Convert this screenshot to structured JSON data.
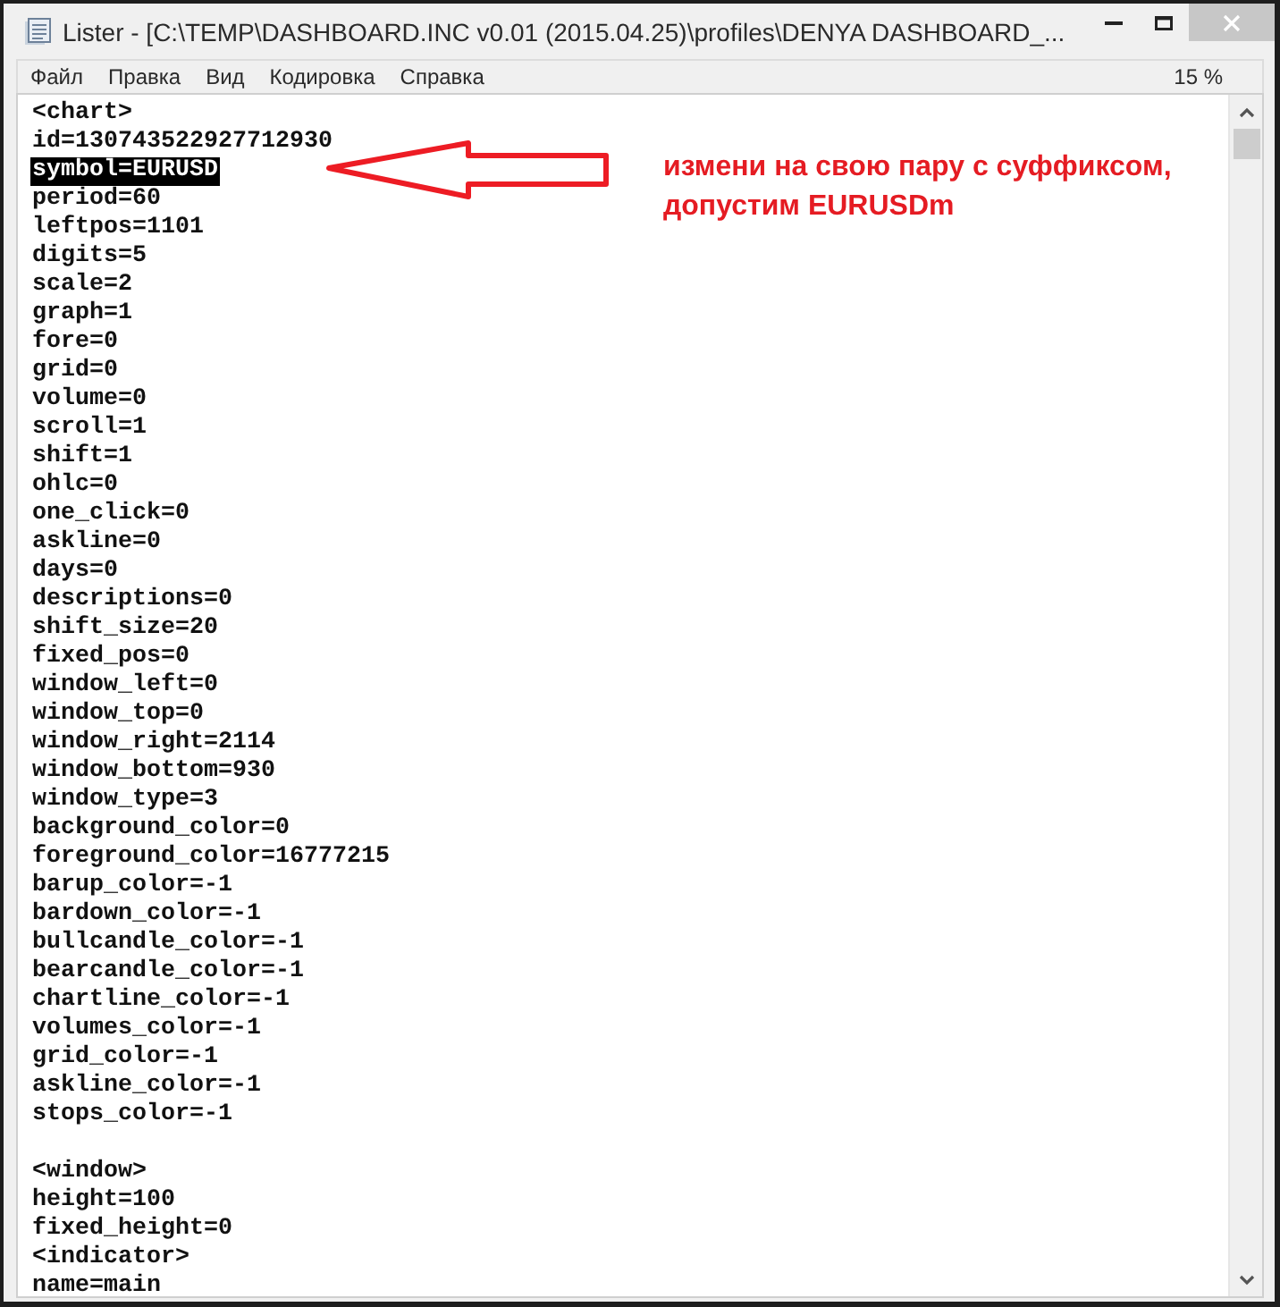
{
  "window": {
    "title": "Lister - [C:\\TEMP\\DASHBOARD.INC v0.01 (2015.04.25)\\profiles\\DENYA DASHBOARD_..."
  },
  "menu": {
    "items": [
      "Файл",
      "Правка",
      "Вид",
      "Кодировка",
      "Справка"
    ],
    "percent": "15 %"
  },
  "editor": {
    "blocks": [
      {
        "lines": [
          {
            "text": "<chart>",
            "selected": false
          },
          {
            "text": "id=130743522927712930",
            "selected": false
          },
          {
            "text": "symbol=EURUSD",
            "selected": true
          },
          {
            "text": "period=60",
            "selected": false
          },
          {
            "text": "leftpos=1101",
            "selected": false
          },
          {
            "text": "digits=5",
            "selected": false
          },
          {
            "text": "scale=2",
            "selected": false
          },
          {
            "text": "graph=1",
            "selected": false
          },
          {
            "text": "fore=0",
            "selected": false
          },
          {
            "text": "grid=0",
            "selected": false
          },
          {
            "text": "volume=0",
            "selected": false
          },
          {
            "text": "scroll=1",
            "selected": false
          },
          {
            "text": "shift=1",
            "selected": false
          },
          {
            "text": "ohlc=0",
            "selected": false
          },
          {
            "text": "one_click=0",
            "selected": false
          },
          {
            "text": "askline=0",
            "selected": false
          },
          {
            "text": "days=0",
            "selected": false
          },
          {
            "text": "descriptions=0",
            "selected": false
          },
          {
            "text": "shift_size=20",
            "selected": false
          },
          {
            "text": "fixed_pos=0",
            "selected": false
          },
          {
            "text": "window_left=0",
            "selected": false
          },
          {
            "text": "window_top=0",
            "selected": false
          },
          {
            "text": "window_right=2114",
            "selected": false
          },
          {
            "text": "window_bottom=930",
            "selected": false
          },
          {
            "text": "window_type=3",
            "selected": false
          },
          {
            "text": "background_color=0",
            "selected": false
          },
          {
            "text": "foreground_color=16777215",
            "selected": false
          },
          {
            "text": "barup_color=-1",
            "selected": false
          },
          {
            "text": "bardown_color=-1",
            "selected": false
          },
          {
            "text": "bullcandle_color=-1",
            "selected": false
          },
          {
            "text": "bearcandle_color=-1",
            "selected": false
          },
          {
            "text": "chartline_color=-1",
            "selected": false
          },
          {
            "text": "volumes_color=-1",
            "selected": false
          },
          {
            "text": "grid_color=-1",
            "selected": false
          },
          {
            "text": "askline_color=-1",
            "selected": false
          },
          {
            "text": "stops_color=-1",
            "selected": false
          }
        ]
      },
      {
        "lines": [
          {
            "text": "<window>",
            "selected": false
          },
          {
            "text": "height=100",
            "selected": false
          },
          {
            "text": "fixed_height=0",
            "selected": false
          },
          {
            "text": "<indicator>",
            "selected": false
          },
          {
            "text": "name=main",
            "selected": false
          }
        ]
      }
    ]
  },
  "annotation": {
    "lines": [
      "измени на свою пару с суффиксом,",
      "допустим EURUSDm"
    ]
  }
}
